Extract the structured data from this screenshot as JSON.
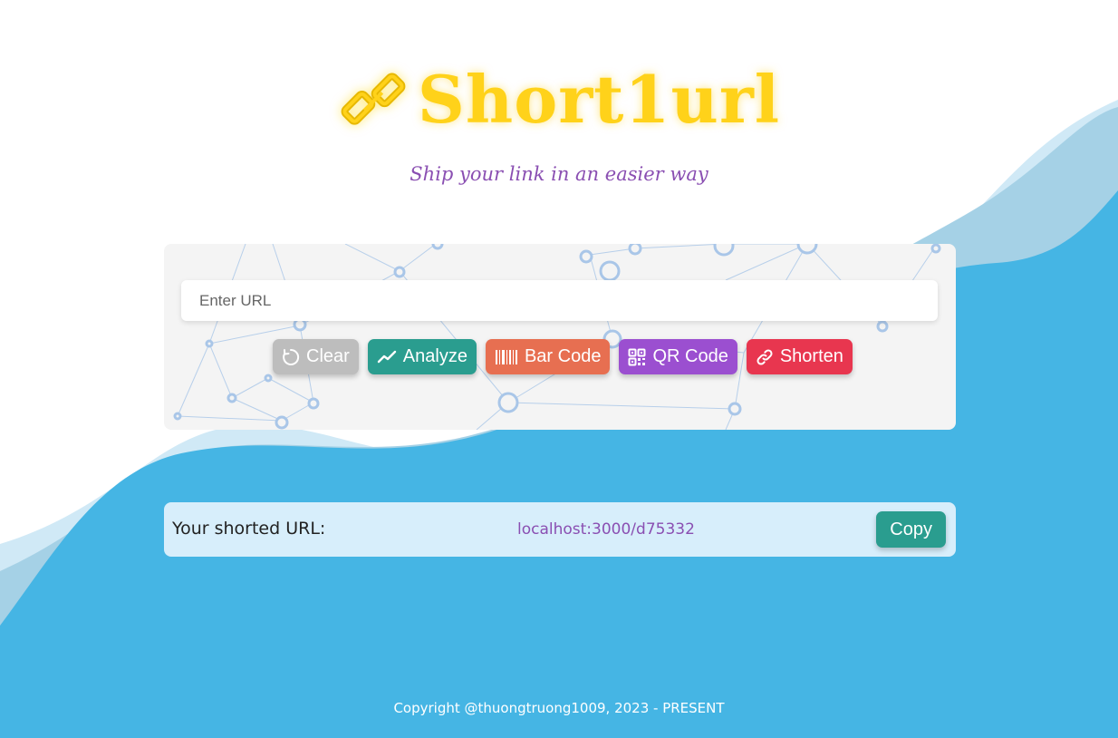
{
  "brand": {
    "logo_icon": "chain-link-icon",
    "name": "Short1url",
    "tagline": "Ship your link in an easier way",
    "accent_color": "#ffd21a",
    "tagline_color": "#8a4fb2"
  },
  "form": {
    "url_placeholder": "Enter URL",
    "url_value": "",
    "buttons": {
      "clear": {
        "label": "Clear",
        "icon": "reset-icon",
        "color": "#bdbdbd"
      },
      "analyze": {
        "label": "Analyze",
        "icon": "trend-line-icon",
        "color": "#2a9d8f"
      },
      "barcode": {
        "label": "Bar Code",
        "icon": "barcode-icon",
        "color": "#e76f51"
      },
      "qrcode": {
        "label": "QR Code",
        "icon": "qr-code-icon",
        "color": "#9b4fd0"
      },
      "shorten": {
        "label": "Shorten",
        "icon": "link-icon",
        "color": "#e8364f"
      }
    }
  },
  "result": {
    "label": "Your shorted URL:",
    "url": "localhost:3000/d75332",
    "copy_label": "Copy"
  },
  "footer": {
    "copyright": "Copyright @thuongtruong1009, 2023 - PRESENT"
  },
  "colors": {
    "wave_blue": "#45b5e4",
    "wave_mid": "#a5d1e6",
    "wave_light": "#d0e9f6"
  }
}
